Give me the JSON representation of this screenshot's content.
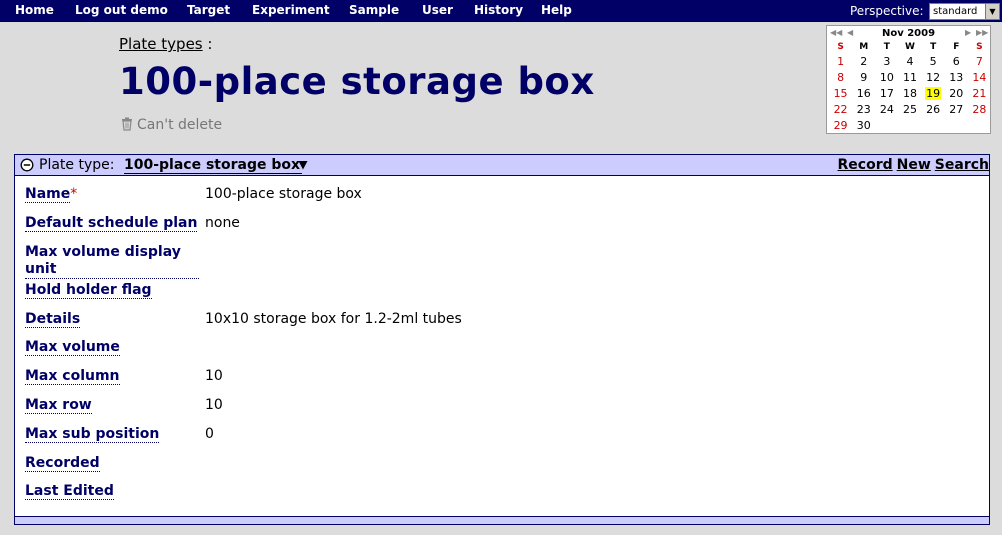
{
  "nav": {
    "items": [
      "Home",
      "Log out demo",
      "Target",
      "Experiment",
      "Sample",
      "User",
      "History",
      "Help"
    ],
    "perspective_label": "Perspective:",
    "perspective_value": "standard"
  },
  "breadcrumb": {
    "link": "Plate types",
    "separator": " :"
  },
  "page_title": "100-place storage box",
  "cant_delete": "Can't delete",
  "calendar": {
    "month": "Nov 2009",
    "weekdays": [
      "S",
      "M",
      "T",
      "W",
      "T",
      "F",
      "S"
    ],
    "weeks": [
      [
        "1",
        "2",
        "3",
        "4",
        "5",
        "6",
        "7"
      ],
      [
        "8",
        "9",
        "10",
        "11",
        "12",
        "13",
        "14"
      ],
      [
        "15",
        "16",
        "17",
        "18",
        "19",
        "20",
        "21"
      ],
      [
        "22",
        "23",
        "24",
        "25",
        "26",
        "27",
        "28"
      ],
      [
        "29",
        "30",
        "",
        "",
        "",
        "",
        ""
      ]
    ],
    "today": "19",
    "weekend_color": "#cc0000",
    "today_color": "#ffff00"
  },
  "panel": {
    "type_label": "Plate type:",
    "type_value": "100-place storage box",
    "actions": [
      "Record",
      "New",
      "Search"
    ],
    "fields": [
      {
        "label": "Name",
        "required": "*",
        "value": "100-place storage box"
      },
      {
        "label": "Default schedule plan",
        "value": "none"
      },
      {
        "label": "Max volume display unit",
        "value": ""
      },
      {
        "label": "Hold holder flag",
        "value": ""
      },
      {
        "label": "Details",
        "value": "10x10 storage box for 1.2-2ml tubes"
      },
      {
        "label": "Max volume",
        "value": ""
      },
      {
        "label": "Max column",
        "value": "10"
      },
      {
        "label": "Max row",
        "value": "10"
      },
      {
        "label": "Max sub position",
        "value": "0"
      },
      {
        "label": "Recorded",
        "value": ""
      },
      {
        "label": "Last Edited",
        "value": ""
      }
    ]
  },
  "colors": {
    "nav_bg": "#000066",
    "title": "#000066",
    "panel_header": "#ccccff",
    "page_bg": "#dcdcdc"
  }
}
